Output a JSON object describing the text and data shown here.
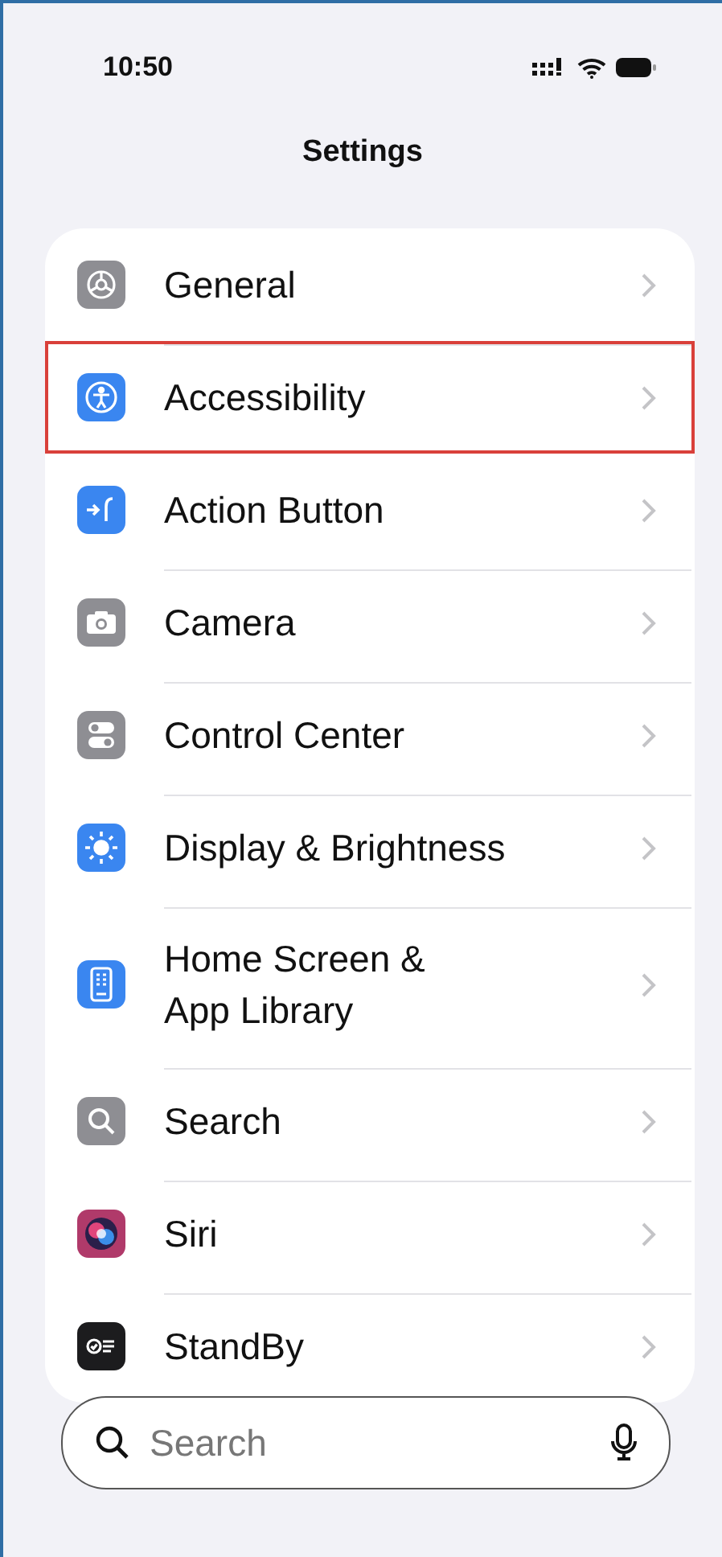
{
  "status_bar": {
    "time": "10:50"
  },
  "title": "Settings",
  "items": [
    {
      "label": "General",
      "color": "#8e8e93",
      "selected": false
    },
    {
      "label": "Accessibility",
      "color": "#3a86f0",
      "selected": true
    },
    {
      "label": "Action Button",
      "color": "#3a86f0",
      "selected": false
    },
    {
      "label": "Camera",
      "color": "#8e8e93",
      "selected": false
    },
    {
      "label": "Control Center",
      "color": "#8e8e93",
      "selected": false
    },
    {
      "label": "Display & Brightness",
      "color": "#3a86f0",
      "selected": false
    },
    {
      "label": "Home Screen &\nApp Library",
      "color": "#3a86f0",
      "selected": false
    },
    {
      "label": "Search",
      "color": "#8e8e93",
      "selected": false
    },
    {
      "label": "Siri",
      "color": "#b03a6a",
      "selected": false
    },
    {
      "label": "StandBy",
      "color": "#1c1c1e",
      "selected": false
    }
  ],
  "search": {
    "placeholder": "Search"
  }
}
